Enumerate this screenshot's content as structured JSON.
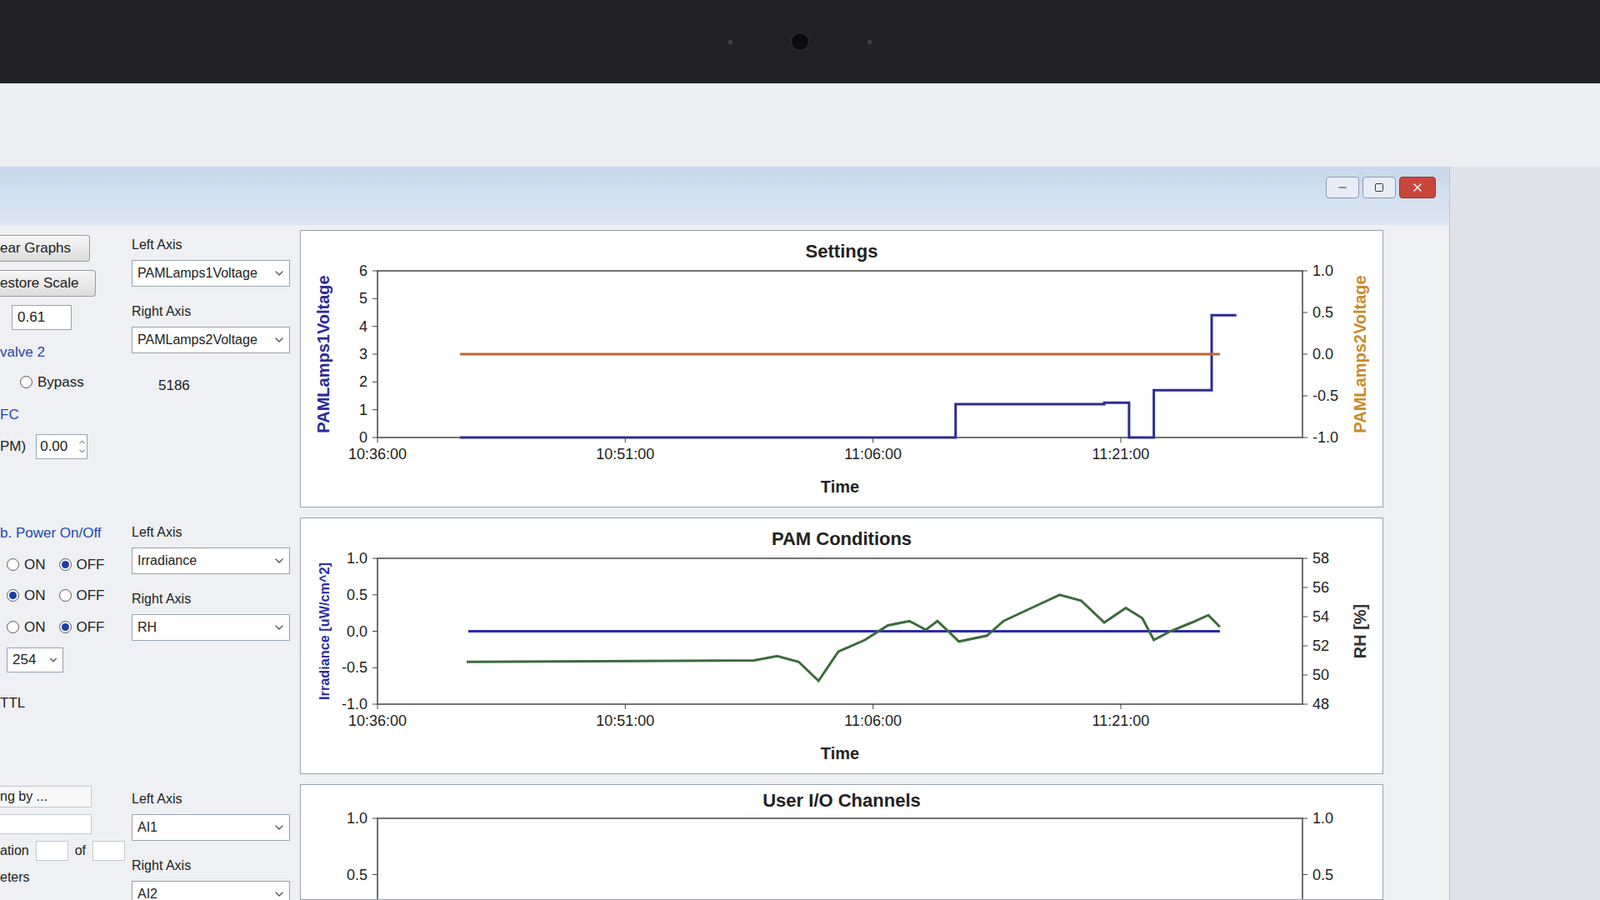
{
  "controls": {
    "clear_graphs": "ear Graphs",
    "restore_scale": "estore Scale",
    "scale_value": "0.61",
    "valve": {
      "label": "valve 2",
      "options": [
        {
          "label": "Bypass",
          "selected": false
        }
      ]
    },
    "counter": "5186",
    "mfc": {
      "label": "FC",
      "field_label": "PM)",
      "value": "0.00"
    },
    "power": {
      "label": "b. Power On/Off",
      "rows": [
        {
          "options": [
            {
              "label": "ON",
              "selected": false
            },
            {
              "label": "OFF",
              "selected": true
            }
          ]
        },
        {
          "options": [
            {
              "label": "ON",
              "selected": true
            },
            {
              "label": "OFF",
              "selected": false
            }
          ]
        },
        {
          "options": [
            {
              "label": "ON",
              "selected": false
            },
            {
              "label": "OFF",
              "selected": true
            }
          ]
        }
      ]
    },
    "select_value": "254",
    "ttl": "TTL",
    "trigger": "ng by ...",
    "iteration": {
      "label": "ation",
      "of": "of"
    },
    "footer": "eters"
  },
  "axis_selectors": [
    {
      "left_label": "Left Axis",
      "left": "PAMLamps1Voltage",
      "right_label": "Right Axis",
      "right": "PAMLamps2Voltage"
    },
    {
      "left_label": "Left Axis",
      "left": "Irradiance",
      "right_label": "Right Axis",
      "right": "RH"
    },
    {
      "left_label": "Left Axis",
      "left": "AI1",
      "right_label": "Right Axis",
      "right": "AI2"
    }
  ],
  "charts": [
    {
      "title": "Settings",
      "x_label": "Time",
      "x_range": [
        636,
        692
      ],
      "x_ticks": [
        "10:36:00",
        "10:51:00",
        "11:06:00",
        "11:21:00"
      ],
      "left": {
        "label": "PAMLamps1Voltage",
        "range": [
          0,
          6
        ],
        "ticks": [
          "0",
          "1",
          "2",
          "3",
          "4",
          "5",
          "6"
        ],
        "color": "#2a2a9c"
      },
      "right": {
        "label": "PAMLamps2Voltage",
        "range": [
          -1,
          1
        ],
        "ticks": [
          "1.0",
          "0.5",
          "0.0",
          "-0.5",
          "-1.0"
        ],
        "color": "#c98a2c"
      },
      "series": [
        {
          "axis": "left",
          "color": "#2d2d8f",
          "x": [
            641,
            671,
            671,
            680,
            680,
            681.5,
            681.5,
            683,
            683,
            686.5,
            686.5,
            688
          ],
          "values": [
            0,
            0,
            1.2,
            1.2,
            1.25,
            1.25,
            0,
            0,
            1.7,
            1.7,
            4.4,
            4.4
          ]
        },
        {
          "axis": "right",
          "color": "#c0672a",
          "x": [
            641,
            687
          ],
          "values": [
            0,
            0
          ]
        }
      ]
    },
    {
      "title": "PAM Conditions",
      "x_label": "Time",
      "x_range": [
        636,
        692
      ],
      "x_ticks": [
        "10:36:00",
        "10:51:00",
        "11:06:00",
        "11:21:00"
      ],
      "left": {
        "label": "Irradiance [uW/cm^2]",
        "range": [
          -1,
          1
        ],
        "ticks": [
          "1.0",
          "0.5",
          "0.0",
          "-0.5",
          "-1.0"
        ],
        "color": "#2a2aa8"
      },
      "right": {
        "label": "RH [%]",
        "range": [
          48,
          58
        ],
        "ticks": [
          "58",
          "56",
          "54",
          "52",
          "50",
          "48"
        ],
        "color": "#333333"
      },
      "series": [
        {
          "axis": "left",
          "color": "#2a2ab0",
          "x": [
            641.5,
            687
          ],
          "values": [
            0,
            0
          ]
        },
        {
          "axis": "right",
          "color": "#3c6b3c",
          "x": [
            641.4,
            658.8,
            660.2,
            661.5,
            662.7,
            663.9,
            665.5,
            666.9,
            668.2,
            669.2,
            669.9,
            671.2,
            672.9,
            673.9,
            675.6,
            677.3,
            678.6,
            680,
            681.3,
            682.3,
            683,
            684,
            685.3,
            686.3,
            687
          ],
          "values": [
            50.9,
            51.0,
            51.3,
            50.9,
            49.6,
            51.6,
            52.4,
            53.4,
            53.7,
            53.1,
            53.7,
            52.3,
            52.7,
            53.7,
            54.6,
            55.5,
            55.1,
            53.6,
            54.6,
            53.9,
            52.4,
            53.0,
            53.6,
            54.1,
            53.3
          ]
        }
      ]
    },
    {
      "title": "User I/O Channels",
      "x_range": [
        636,
        692
      ],
      "left": {
        "range": [
          -1,
          1
        ],
        "ticks": [
          "1.0",
          "0.5"
        ],
        "color": "#333333"
      },
      "right": {
        "range": [
          -1,
          1
        ],
        "ticks": [
          "1.0",
          "0.5"
        ],
        "color": "#333333"
      },
      "series": []
    }
  ]
}
